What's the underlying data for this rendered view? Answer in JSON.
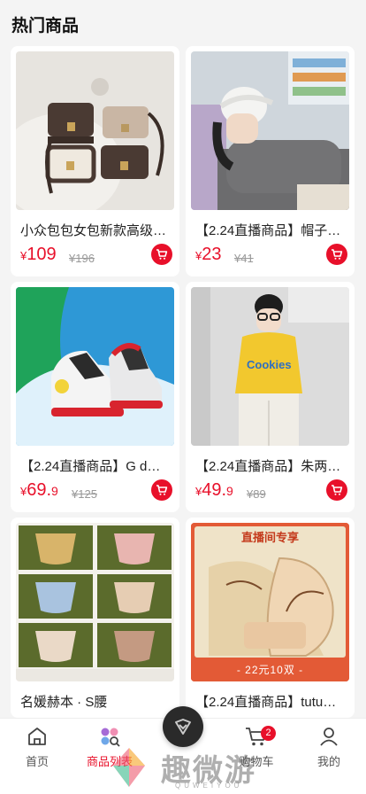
{
  "header": {
    "title": "热门商品"
  },
  "products": [
    {
      "title": "小众包包女包新款高级感…",
      "currency": "¥",
      "price_int": "109",
      "price_dec": "",
      "original": "¥196"
    },
    {
      "title": "【2.24直播商品】帽子…",
      "currency": "¥",
      "price_int": "23",
      "price_dec": "",
      "original": "¥41"
    },
    {
      "title": "【2.24直播商品】G d…",
      "currency": "¥",
      "price_int": "69.",
      "price_dec": "9",
      "original": "¥125"
    },
    {
      "title": "【2.24直播商品】朱两…",
      "currency": "¥",
      "price_int": "49.",
      "price_dec": "9",
      "original": "¥89"
    },
    {
      "title": "名媛赫本 · S腰",
      "currency": "",
      "price_int": "",
      "price_dec": "",
      "original": ""
    },
    {
      "title": "【2.24直播商品】tutu…",
      "currency": "",
      "price_int": "",
      "price_dec": "",
      "original": "",
      "banner_top": "直播间专享",
      "banner_bottom": "- 22元10双 -"
    }
  ],
  "tabbar": {
    "items": [
      {
        "label": "首页",
        "icon": "home-icon"
      },
      {
        "label": "商品列表",
        "icon": "product-list-icon"
      },
      {
        "label": "",
        "icon": "live-center-icon"
      },
      {
        "label": "购物车",
        "icon": "cart-icon",
        "badge": "2"
      },
      {
        "label": "我的",
        "icon": "profile-icon"
      }
    ]
  },
  "watermark": {
    "text": "趣微游",
    "sub": "QUWEIYOU"
  },
  "colors": {
    "accent": "#e8102a",
    "background": "#f4f4f4"
  }
}
